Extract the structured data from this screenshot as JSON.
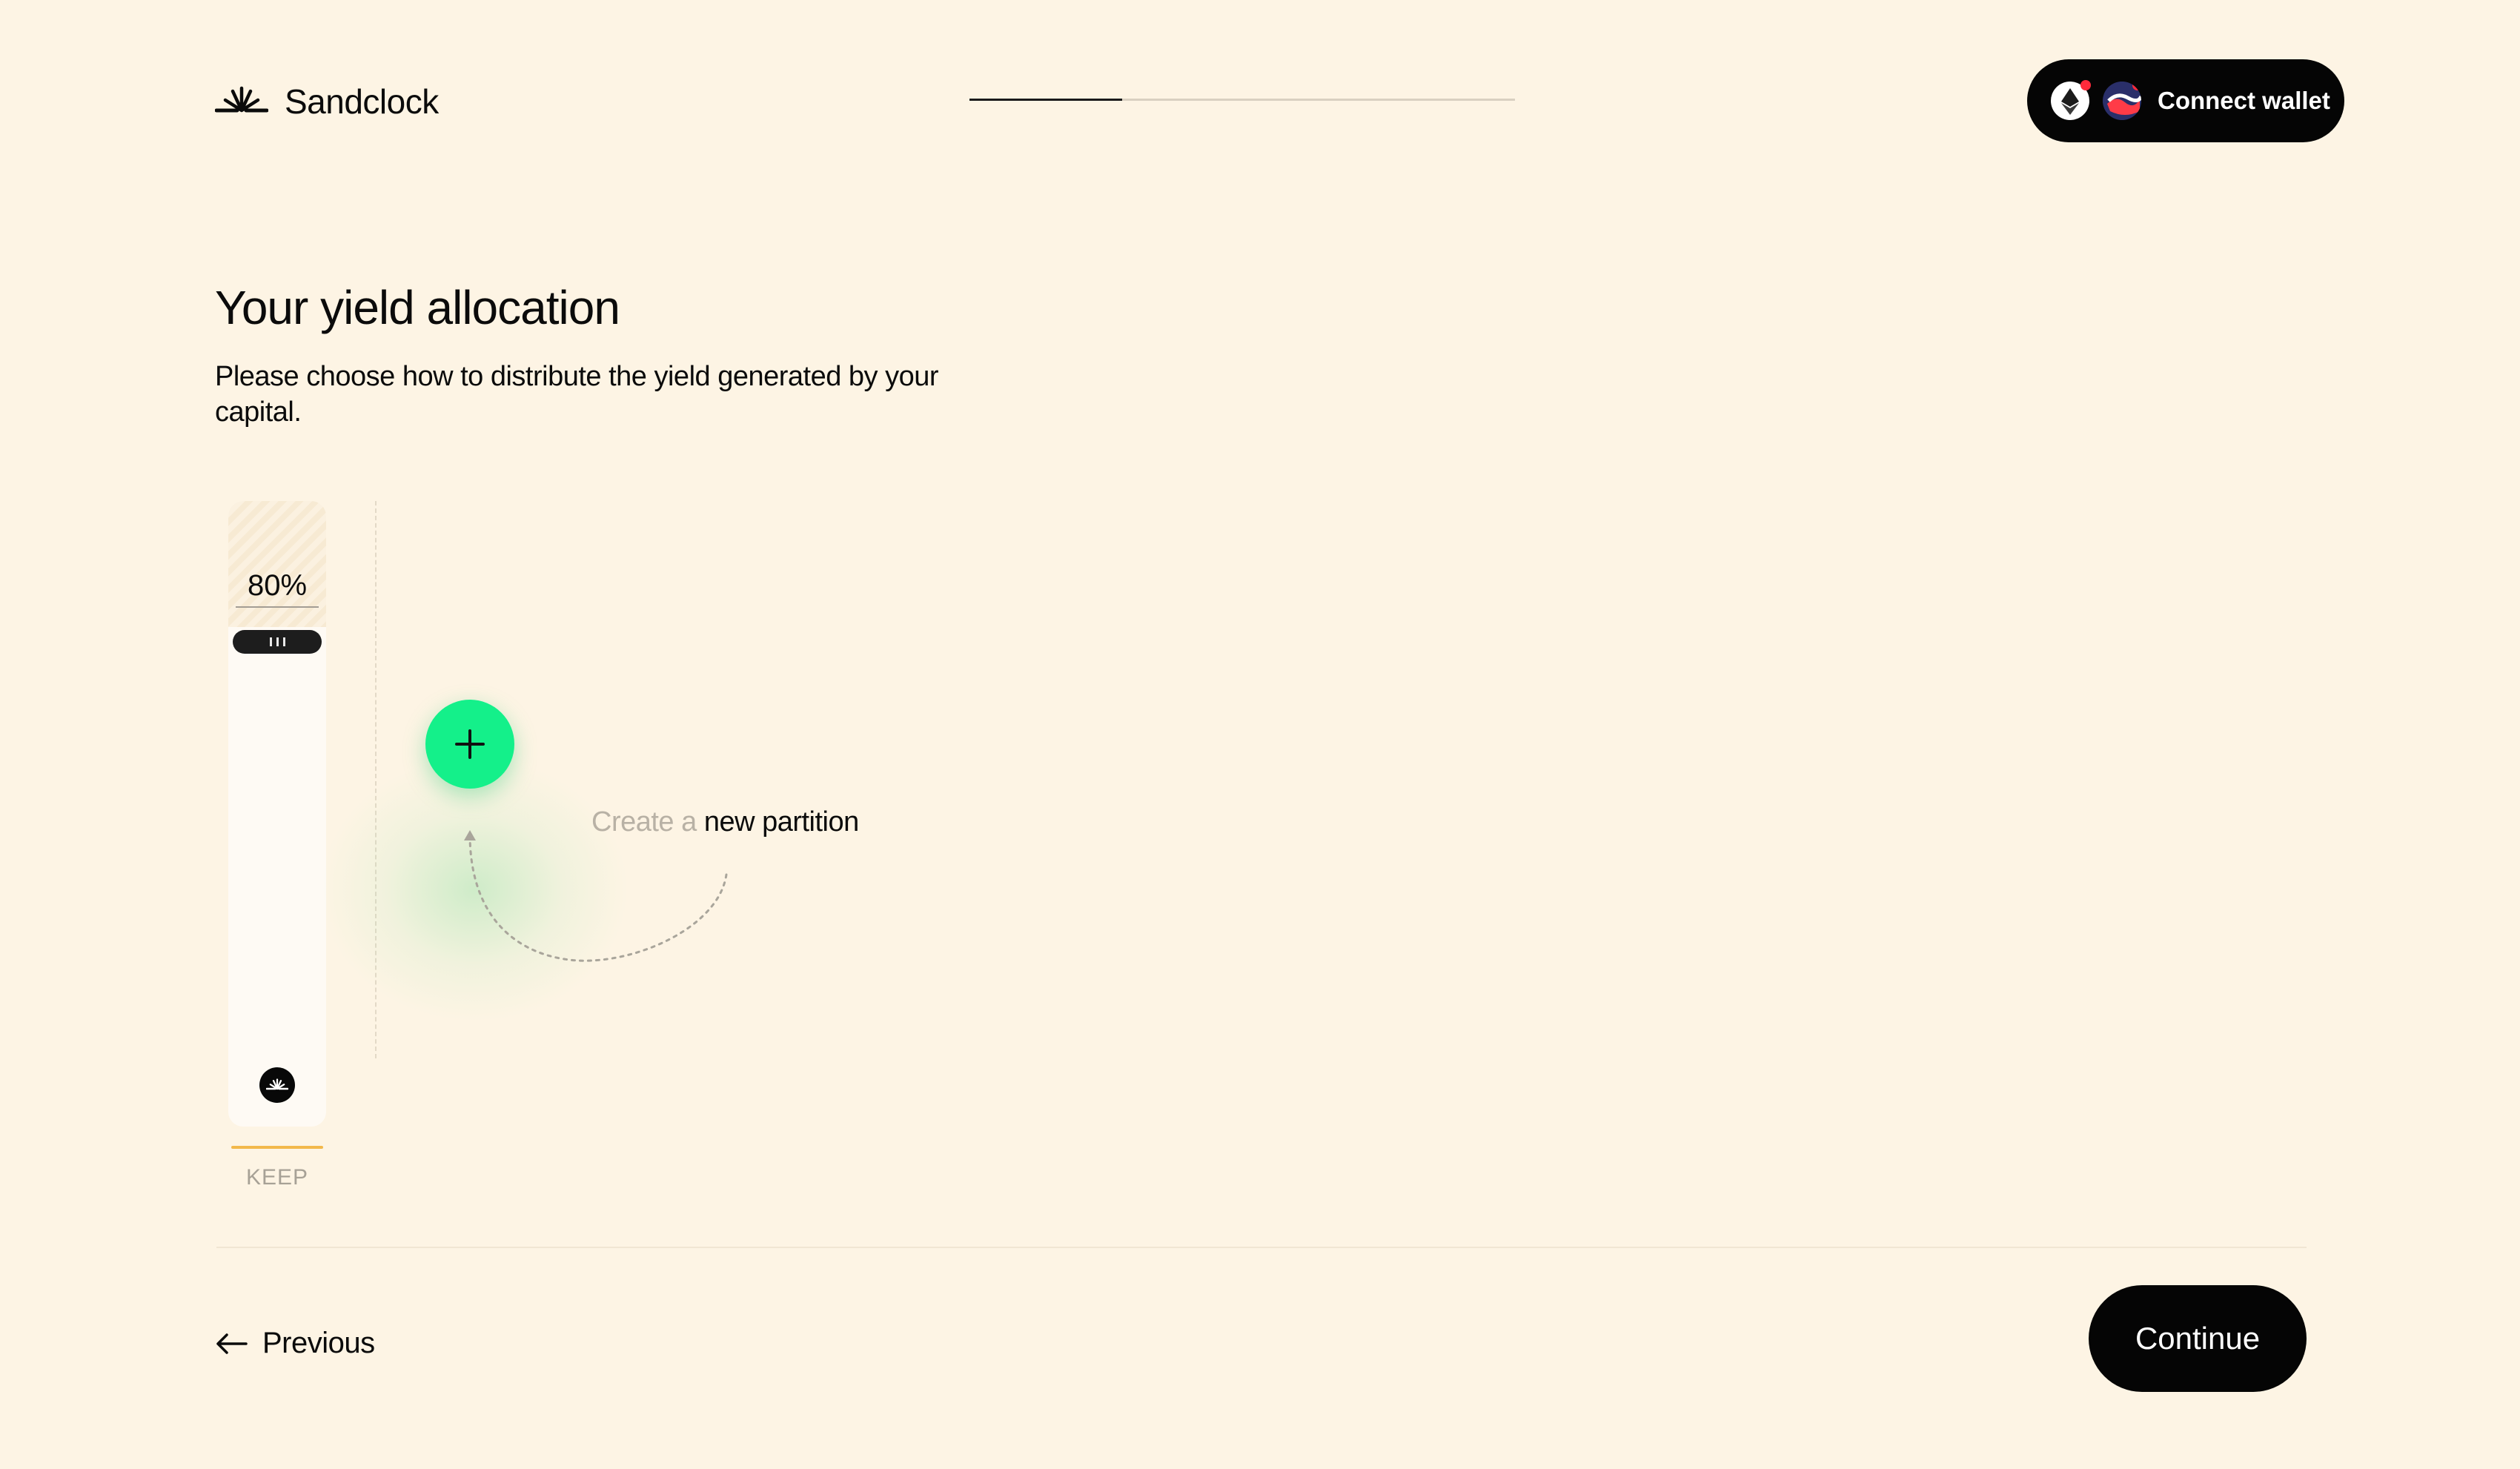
{
  "brand": {
    "name": "Sandclock"
  },
  "progress": {
    "fraction": 0.28
  },
  "header": {
    "connect_label": "Connect wallet"
  },
  "page": {
    "title": "Your yield allocation",
    "subtitle": "Please choose how to distribute the yield generated by your capital."
  },
  "partition": {
    "percent_label": "80%",
    "name": "KEEP",
    "accent": "#f2b84b"
  },
  "create": {
    "muted": "Create a ",
    "emphasis": "new partition"
  },
  "footer": {
    "previous_label": "Previous",
    "continue_label": "Continue"
  },
  "colors": {
    "background": "#fdf4e4",
    "add_button": "#14f08a",
    "dark": "#050505"
  },
  "icons": [
    "sandclock-logo-icon",
    "ethereum-icon",
    "optimism-icon",
    "drag-handle-icon",
    "plus-icon",
    "arrow-left-icon",
    "dashed-arrow-icon"
  ]
}
